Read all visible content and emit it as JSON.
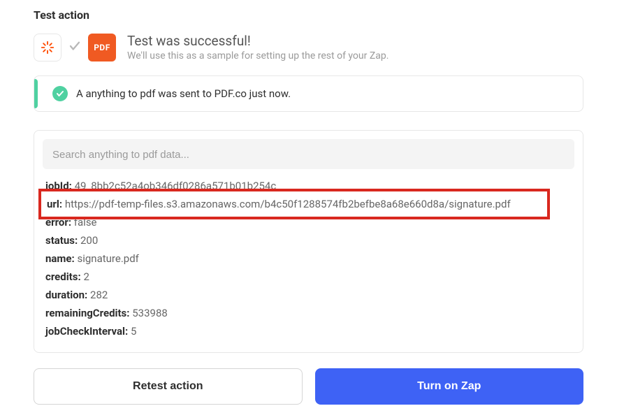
{
  "section_title": "Test action",
  "header": {
    "success_title": "Test was successful!",
    "success_sub": "We'll use this as a sample for setting up the rest of your Zap.",
    "pdf_label": "PDF"
  },
  "status": {
    "message": "A anything to pdf was sent to PDF.co just now."
  },
  "search": {
    "placeholder": "Search anything to pdf data..."
  },
  "data": {
    "jobId": {
      "key": "jobId:",
      "value": "49_8bb2c52a4ob346df0286a571b01b254c"
    },
    "url": {
      "key": "url:",
      "value": "https://pdf-temp-files.s3.amazonaws.com/b4c50f1288574fb2befbe8a68e660d8a/signature.pdf"
    },
    "error": {
      "key": "error:",
      "value": "false"
    },
    "status": {
      "key": "status:",
      "value": "200"
    },
    "name": {
      "key": "name:",
      "value": "signature.pdf"
    },
    "credits": {
      "key": "credits:",
      "value": "2"
    },
    "duration": {
      "key": "duration:",
      "value": "282"
    },
    "remainingCredits": {
      "key": "remainingCredits:",
      "value": "533988"
    },
    "jobCheckInterval": {
      "key": "jobCheckInterval:",
      "value": "5"
    }
  },
  "buttons": {
    "retest": "Retest action",
    "turn_on": "Turn on Zap"
  }
}
